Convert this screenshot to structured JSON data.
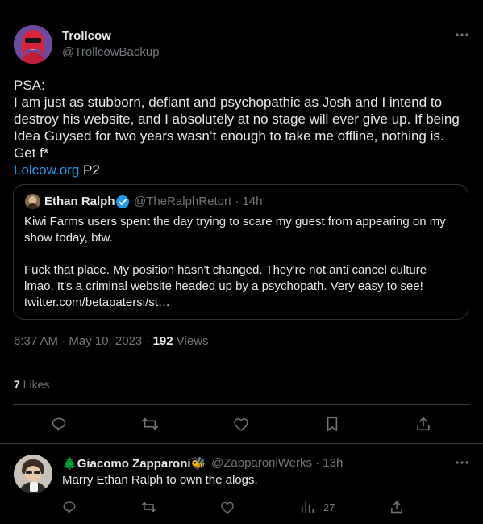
{
  "tweet": {
    "author_name": "Trollcow",
    "author_handle": "@TrollcowBackup",
    "text_line1": "PSA:",
    "text_line2": "I am just as stubborn, defiant and psychopathic as Josh and I intend to",
    "text_line3": "destroy his website, and I absolutely at no stage will ever give up. If being",
    "text_line4": "Idea Guysed for two years wasn’t enough to take me offline, nothing is.",
    "text_line5": "Get f*",
    "link_text": "Lolcow.org",
    "link_suffix": " P2",
    "timestamp": "6:37 AM · May 10, 2023 · ",
    "views_count": "192",
    "views_label": " Views",
    "likes_count": "7",
    "likes_label": " Likes"
  },
  "quote": {
    "author_name": "Ethan Ralph",
    "author_handle": "@TheRalphRetort · 14h",
    "line1": "Kiwi Farms users spent the day trying to scare my guest from appearing on my",
    "line2": "show today, btw.",
    "line3": "Fuck that place. My position hasn't changed. They're not anti cancel culture",
    "line4": "lmao. It's a criminal website headed up by a psychopath. Very easy to see!",
    "line5": "twitter.com/betapatersi/st…"
  },
  "reply": {
    "author_prefix": "🌲",
    "author_name": "Giacomo Zapparoni",
    "author_suffix": "🐝",
    "author_handle": "@ZapparoniWerks · 13h",
    "text": "Marry Ethan Ralph to own the alogs.",
    "views_count": "27"
  },
  "icons": [
    "more-icon",
    "verified-icon",
    "reply-icon",
    "retweet-icon",
    "like-icon",
    "bookmark-icon",
    "share-icon",
    "analytics-icon"
  ],
  "colors": {
    "background": "#000000",
    "text": "#e7e9ea",
    "muted": "#71767b",
    "link": "#1d9bf0",
    "divider": "#2f3336",
    "verified": "#1d9bf0"
  }
}
